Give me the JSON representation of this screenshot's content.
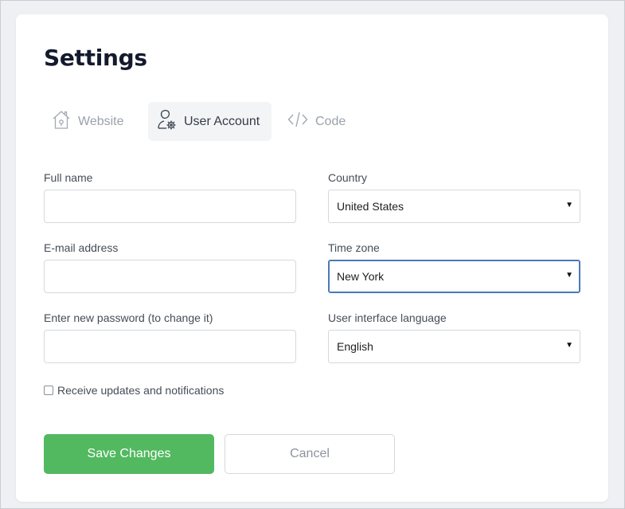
{
  "page": {
    "title": "Settings"
  },
  "tabs": [
    {
      "label": "Website",
      "icon": "home-icon",
      "active": false
    },
    {
      "label": "User Account",
      "icon": "user-settings-icon",
      "active": true
    },
    {
      "label": "Code",
      "icon": "code-icon",
      "active": false
    }
  ],
  "form": {
    "full_name": {
      "label": "Full name",
      "value": ""
    },
    "email": {
      "label": "E-mail address",
      "value": ""
    },
    "password": {
      "label": "Enter new password (to change it)",
      "value": ""
    },
    "country": {
      "label": "Country",
      "value": "United States"
    },
    "timezone": {
      "label": "Time zone",
      "value": "New York"
    },
    "language": {
      "label": "User interface language",
      "value": "English"
    },
    "notifications": {
      "label": "Receive updates and notifications",
      "checked": false
    }
  },
  "actions": {
    "save_label": "Save Changes",
    "cancel_label": "Cancel"
  },
  "colors": {
    "accent": "#52b960",
    "focus": "#4a79b8",
    "title": "#141a2e"
  }
}
